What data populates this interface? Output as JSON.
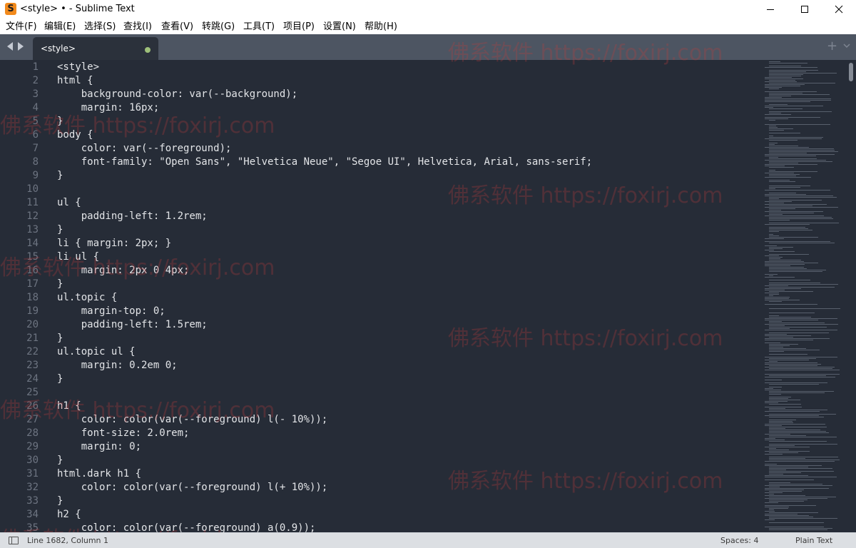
{
  "window": {
    "app_icon_glyph": "S",
    "title": "<style> • - Sublime Text"
  },
  "menu": {
    "items": [
      "文件(F)",
      "编辑(E)",
      "选择(S)",
      "查找(I)",
      "查看(V)",
      "转跳(G)",
      "工具(T)",
      "项目(P)",
      "设置(N)",
      "帮助(H)"
    ]
  },
  "tabs": {
    "items": [
      {
        "label": "<style>",
        "modified": true
      }
    ],
    "add_label": "+"
  },
  "editor": {
    "line_numbers": [
      "1",
      "2",
      "3",
      "4",
      "5",
      "6",
      "7",
      "8",
      "9",
      "10",
      "11",
      "12",
      "13",
      "14",
      "15",
      "16",
      "17",
      "18",
      "19",
      "20",
      "21",
      "22",
      "23",
      "24",
      "25",
      "26",
      "27",
      "28",
      "29",
      "30",
      "31",
      "32",
      "33",
      "34",
      "35"
    ],
    "lines": [
      "<style>",
      "html {",
      "    background-color: var(--background);",
      "    margin: 16px;",
      "}",
      "body {",
      "    color: var(--foreground);",
      "    font-family: \"Open Sans\", \"Helvetica Neue\", \"Segoe UI\", Helvetica, Arial, sans-serif;",
      "}",
      "",
      "ul {",
      "    padding-left: 1.2rem;",
      "}",
      "li { margin: 2px; }",
      "li ul {",
      "    margin: 2px 0 4px;",
      "}",
      "ul.topic {",
      "    margin-top: 0;",
      "    padding-left: 1.5rem;",
      "}",
      "ul.topic ul {",
      "    margin: 0.2em 0;",
      "}",
      "",
      "h1 {",
      "    color: color(var(--foreground) l(- 10%));",
      "    font-size: 2.0rem;",
      "    margin: 0;",
      "}",
      "html.dark h1 {",
      "    color: color(var(--foreground) l(+ 10%));",
      "}",
      "h2 {",
      "    color: color(var(--foreground) a(0.9));"
    ]
  },
  "watermarks": [
    "佛系软件 https://foxirj.com",
    "佛系软件 https://foxirj.com",
    "佛系软件 https://foxirj.com",
    "佛系软件 https://foxirj.com",
    "佛系软件 https://foxirj.com",
    "佛系软件 https://foxirj.com",
    "佛系软件 https://foxirj.com",
    "佛系软件 https://foxirj.com",
    "佛系软件 https://foxirj.com"
  ],
  "status": {
    "position": "Line 1682, Column 1",
    "indent": "Spaces: 4",
    "syntax": "Plain Text"
  },
  "colors": {
    "editor_bg": "#262c37",
    "tabbar_bg": "#4d5562",
    "active_tab_bg": "#2b313b",
    "modified_dot": "#9ec07a",
    "app_icon": "#f28a1c"
  },
  "icons": [
    "app-icon",
    "minimize-icon",
    "maximize-icon",
    "close-icon",
    "arrow-left-icon",
    "arrow-right-icon",
    "new-tab-icon",
    "chevron-down-icon",
    "panel-toggle-icon"
  ]
}
